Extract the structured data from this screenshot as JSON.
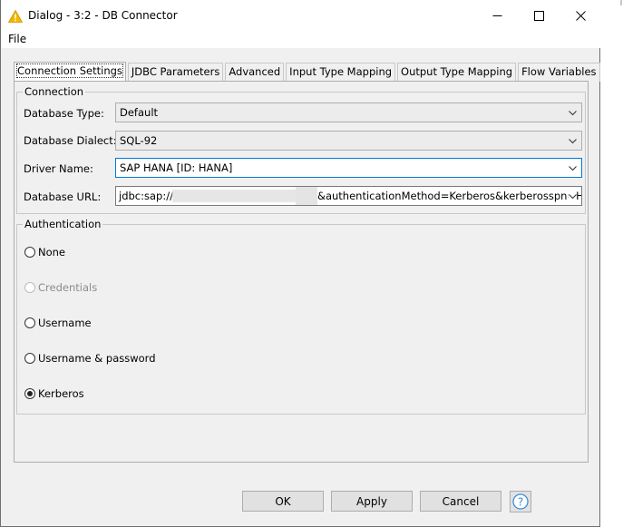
{
  "window": {
    "title": "Dialog - 3:2 - DB Connector",
    "icon": "warning-triangle-icon",
    "controls": [
      "minimize-icon",
      "maximize-icon",
      "close-icon"
    ]
  },
  "menu": {
    "file_label": "File"
  },
  "tabs": [
    {
      "label": "Connection Settings",
      "active": true
    },
    {
      "label": "JDBC Parameters"
    },
    {
      "label": "Advanced"
    },
    {
      "label": "Input Type Mapping"
    },
    {
      "label": "Output Type Mapping"
    },
    {
      "label": "Flow Variables"
    }
  ],
  "connection": {
    "legend": "Connection",
    "database_type": {
      "label": "Database Type:",
      "value": "Default"
    },
    "database_dialect": {
      "label": "Database Dialect:",
      "value": "SQL-92"
    },
    "driver_name": {
      "label": "Driver Name:",
      "value": "SAP HANA [ID: HANA]"
    },
    "database_url": {
      "label": "Database URL:",
      "value_prefix": "jdbc:sap://",
      "value_suffix": "&authenticationMethod=Kerberos&kerberosspn=HTTP/p"
    }
  },
  "authentication": {
    "legend": "Authentication",
    "options": [
      {
        "label": "None",
        "checked": false,
        "enabled": true
      },
      {
        "label": "Credentials",
        "checked": false,
        "enabled": false
      },
      {
        "label": "Username",
        "checked": false,
        "enabled": true
      },
      {
        "label": "Username & password",
        "checked": false,
        "enabled": true
      },
      {
        "label": "Kerberos",
        "checked": true,
        "enabled": true
      }
    ]
  },
  "buttons": {
    "ok": "OK",
    "apply": "Apply",
    "cancel": "Cancel",
    "help_icon": "question-mark-icon"
  },
  "colors": {
    "focus_border": "#0078d7",
    "warning_icon": "#f2b600",
    "help_icon": "#3c8dd8"
  }
}
